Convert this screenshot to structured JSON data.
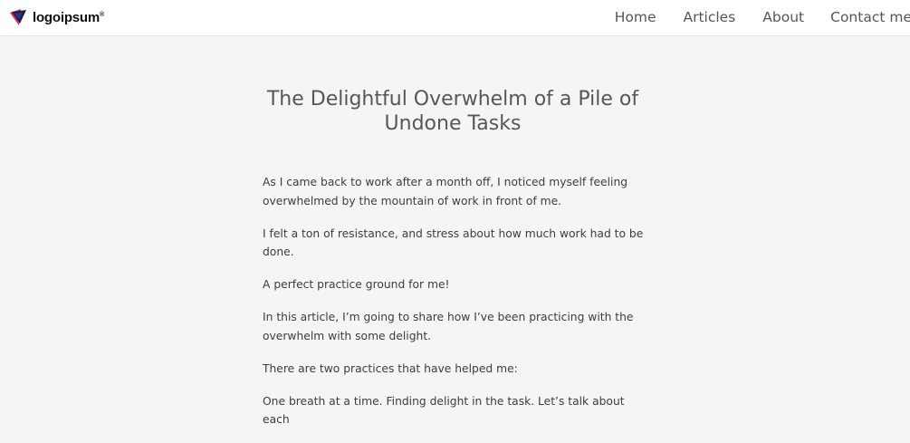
{
  "header": {
    "logo_text": "logoipsum",
    "logo_mark": "®",
    "nav": {
      "home": "Home",
      "articles": "Articles",
      "about": "About",
      "contact": "Contact me"
    }
  },
  "article": {
    "title_line1": "The Delightful Overwhelm of a Pile of",
    "title_line2": "Undone Tasks",
    "paragraphs": [
      "As I came back to work after a month off, I noticed myself feeling overwhelmed by the mountain of work in front of me.",
      "I felt a ton of resistance, and stress about how much work had to be done.",
      "A perfect practice ground for me!",
      "In this article, I’m going to share how I’ve been practicing with the overwhelm with some delight.",
      "There are two practices that have helped me:",
      "One breath at a time. Finding delight in the task. Let’s talk about each"
    ]
  },
  "colors": {
    "background": "#f5f5f5",
    "header_bg": "#ffffff",
    "logo_dark": "#1b1f3a",
    "logo_accent": "#e0206a"
  }
}
